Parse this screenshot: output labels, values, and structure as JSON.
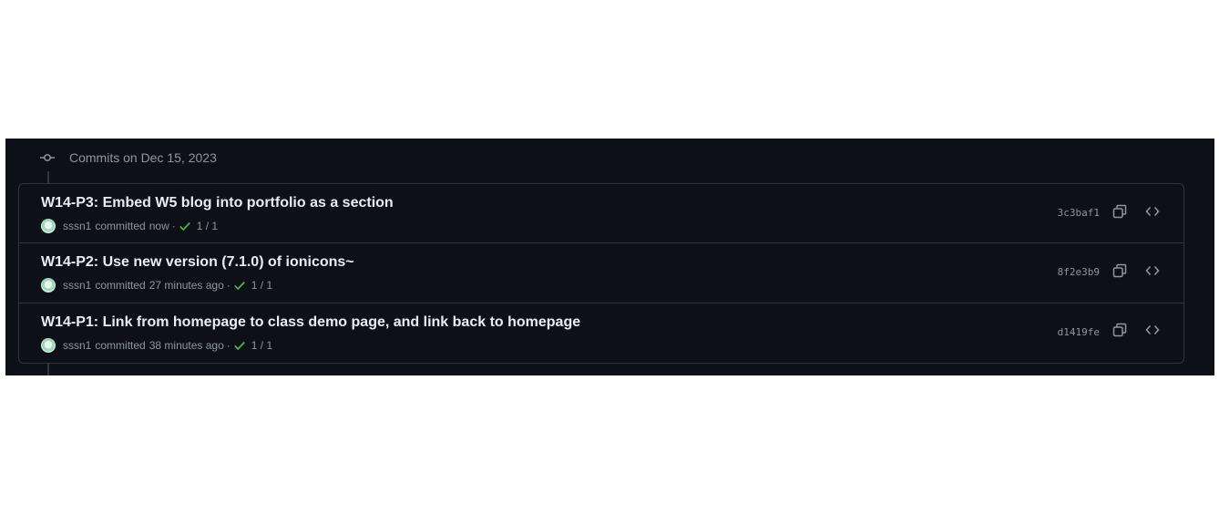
{
  "group": {
    "title": "Commits on Dec 15, 2023"
  },
  "commits": [
    {
      "title": "W14-P3: Embed W5 blog into portfolio as a section",
      "author": "sssn1",
      "verb": "committed",
      "time": "now",
      "separator": "·",
      "checks": "1 / 1",
      "sha": "3c3baf1"
    },
    {
      "title": "W14-P2: Use new version (7.1.0) of ionicons~",
      "author": "sssn1",
      "verb": "committed",
      "time": "27 minutes ago",
      "separator": "·",
      "checks": "1 / 1",
      "sha": "8f2e3b9"
    },
    {
      "title": "W14-P1: Link from homepage to class demo page, and link back to homepage",
      "author": "sssn1",
      "verb": "committed",
      "time": "38 minutes ago",
      "separator": "·",
      "checks": "1 / 1",
      "sha": "d1419fe"
    }
  ],
  "icons": {
    "group": "git-commit-icon",
    "status": "check-icon",
    "copy": "copy-icon",
    "browse": "code-icon"
  },
  "colors": {
    "background": "#0d1117",
    "border": "#30363d",
    "text_primary": "#e6edf3",
    "text_muted": "#8d96a0",
    "success": "#3fb950"
  }
}
